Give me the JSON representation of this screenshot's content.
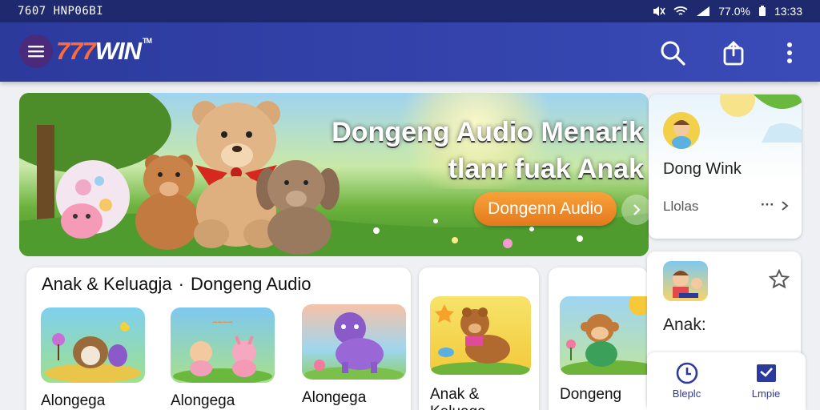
{
  "status_bar": {
    "left_text": "7607 HNP06BI",
    "battery": "77.0%",
    "time": "13:33"
  },
  "app_bar": {
    "logo_num": "777",
    "logo_text": "WIN",
    "logo_tm": "TM"
  },
  "hero": {
    "title_line1": "Dongeng Audio Menarik",
    "title_line2": "tlanr fuak Anak",
    "button_label": "Dongenn Audio"
  },
  "section": {
    "title_part1": "Anak & Keluagja",
    "separator": "·",
    "title_part2": "Dongeng Audio",
    "items": [
      {
        "label": "Alongega"
      },
      {
        "label": "Alongega"
      },
      {
        "label": "Alongega"
      }
    ]
  },
  "cards": [
    {
      "label": "Anak & Keluaga"
    },
    {
      "label": "Dongeng"
    }
  ],
  "side_card_1": {
    "title": "Dong Wink",
    "subtitle": "Llolas",
    "more": "···"
  },
  "side_card_2": {
    "title": "Anak:"
  },
  "bottom_nav": {
    "items": [
      {
        "label": "Bleplc"
      },
      {
        "label": "Lmpie"
      }
    ]
  },
  "colors": {
    "status_bar": "#1f2a6e",
    "app_bar": "#3a4bb8",
    "accent_orange": "#ee8a28",
    "nav_blue": "#2c3a9c"
  }
}
